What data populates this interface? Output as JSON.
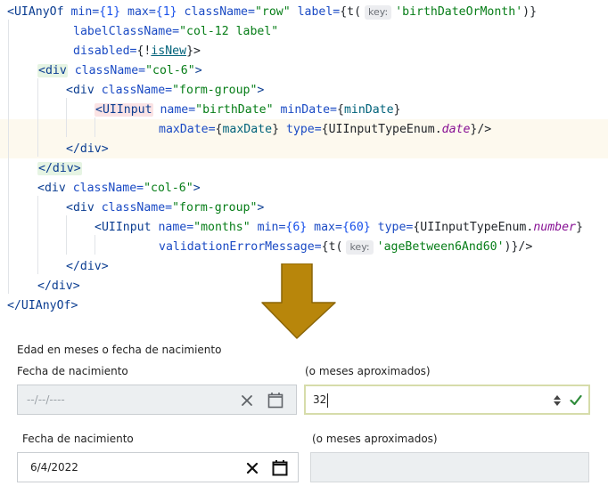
{
  "code": {
    "l1_tag": "<UIAnyOf",
    "l1_a1": " min=",
    "l1_v1": "{1}",
    "l1_a2": " max=",
    "l1_v2": "{1}",
    "l1_a3": " className=",
    "l1_v3": "\"row\"",
    "l1_a4": " label=",
    "l1_v4a": "{t(",
    "l1_hint": "key:",
    "l1_v4b": "'birthDateOrMonth'",
    "l1_v4c": ")}",
    "l2_a": "labelClassName=",
    "l2_v": "\"col-12 label\"",
    "l3_a": "disabled=",
    "l3_v1": "{!",
    "l3_v2": "isNew",
    "l3_v3": "}>",
    "l4_tag": "<div",
    "l4_a": " className=",
    "l4_v": "\"col-6\"",
    "l4_end": ">",
    "l5_tag": "<div",
    "l5_a": " className=",
    "l5_v": "\"form-group\"",
    "l5_end": ">",
    "l6_tag": "<UIInput",
    "l6_a1": " name=",
    "l6_v1": "\"birthDate\"",
    "l6_a2": " minDate=",
    "l6_v2a": "{",
    "l6_v2b": "minDate",
    "l6_v2c": "}",
    "l7_a1": "maxDate=",
    "l7_v1a": "{",
    "l7_v1b": "maxDate",
    "l7_v1c": "}",
    "l7_a2": " type=",
    "l7_v2a": "{UIInputTypeEnum.",
    "l7_v2b": "date",
    "l7_v2c": "}/>",
    "l8": "</div>",
    "l9": "</div>",
    "l10_tag": "<div",
    "l10_a": " className=",
    "l10_v": "\"col-6\"",
    "l10_end": ">",
    "l11_tag": "<div",
    "l11_a": " className=",
    "l11_v": "\"form-group\"",
    "l11_end": ">",
    "l12_tag": "<UIInput",
    "l12_a1": " name=",
    "l12_v1": "\"months\"",
    "l12_a2": " min=",
    "l12_v2": "{6}",
    "l12_a3": " max=",
    "l12_v3": "{60}",
    "l12_a4": " type=",
    "l12_v4a": "{UIInputTypeEnum.",
    "l12_v4b": "number",
    "l12_v4c": "}",
    "l13_a": "validationErrorMessage=",
    "l13_v1": "{t(",
    "l13_hint": "key:",
    "l13_v2": "'ageBetween6And60'",
    "l13_v3": ")}/>",
    "l14": "</div>",
    "l15": "</div>",
    "l16": "</UIAnyOf>"
  },
  "form": {
    "group_label": "Edad en meses o fecha de nacimiento",
    "row1": {
      "date_label": "Fecha de nacimiento",
      "date_placeholder": "--/--/----",
      "months_label": "(o meses aproximados)",
      "months_value": "32"
    },
    "row2": {
      "date_label": "Fecha de nacimiento",
      "date_value": "6/4/2022",
      "months_label": "(o meses aproximados)"
    }
  },
  "colors": {
    "arrow": "#b8860b",
    "valid_check": "#2e8b3a",
    "valid_border": "#d6dcaa"
  },
  "icons": [
    "clear-x-icon",
    "calendar-icon",
    "spinner-icon",
    "check-icon",
    "down-arrow-icon"
  ]
}
